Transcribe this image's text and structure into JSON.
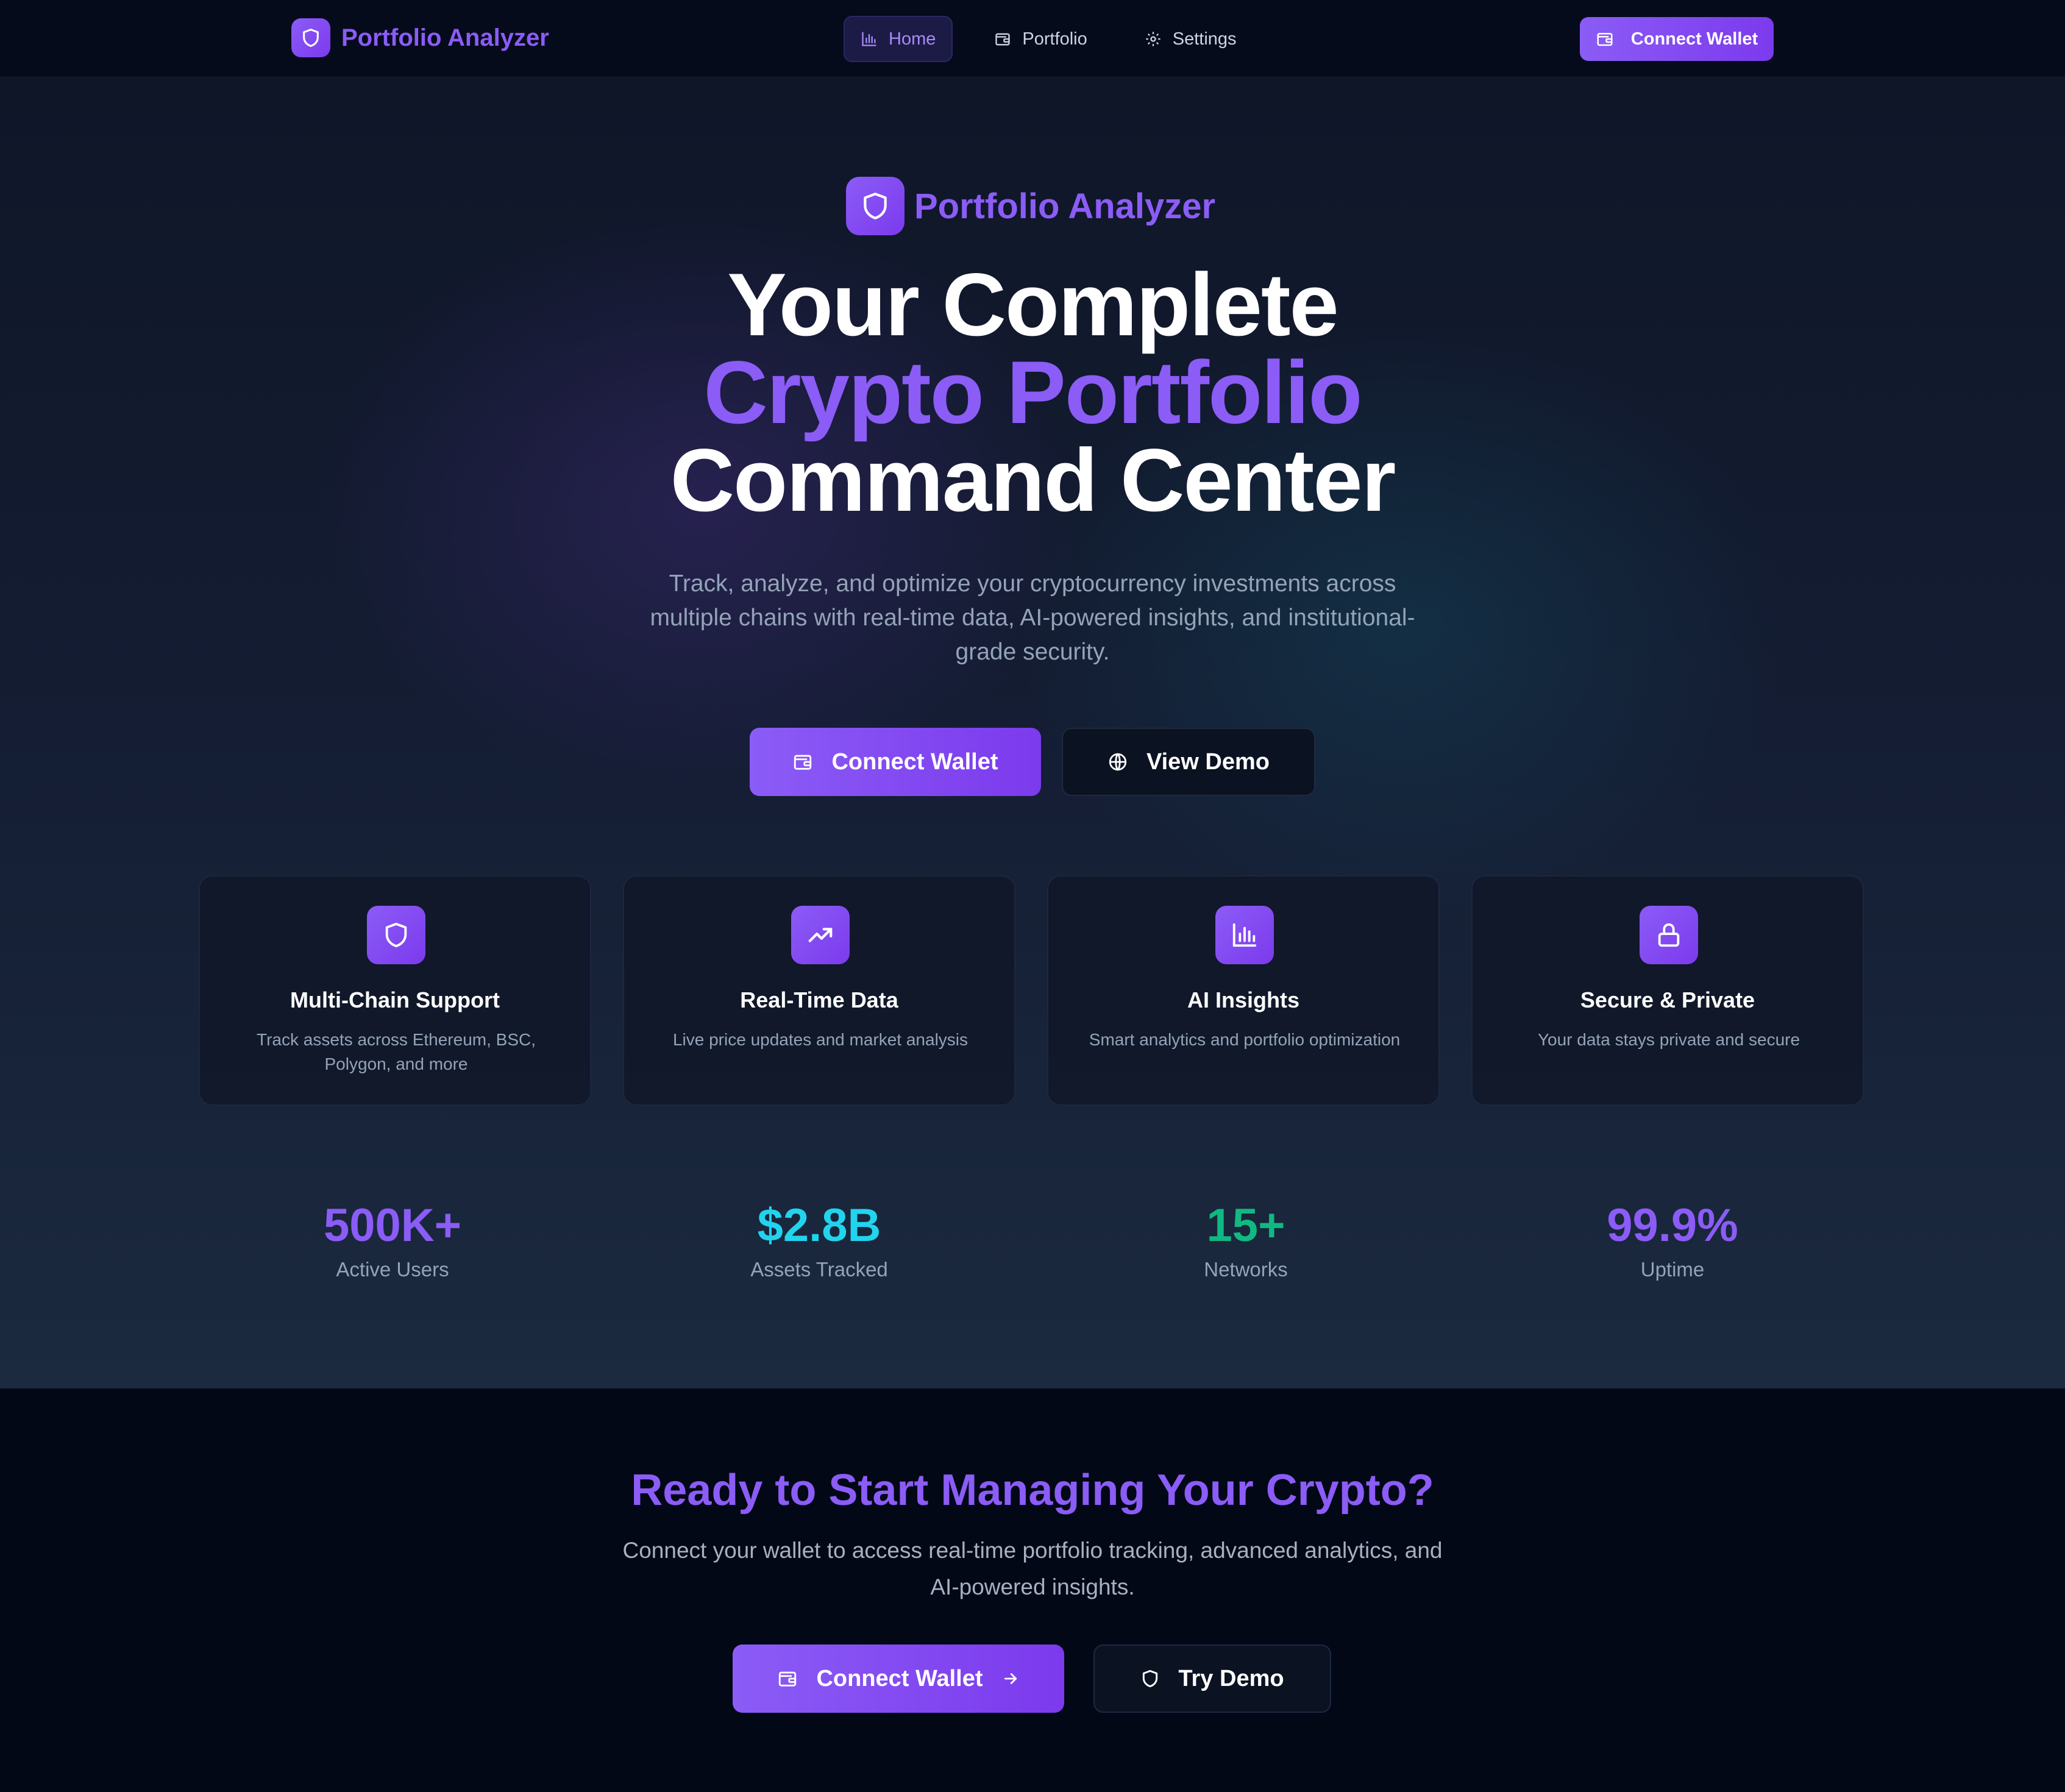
{
  "nav": {
    "brand": "Portfolio Analyzer",
    "links": [
      {
        "label": "Home",
        "icon": "bar-chart-icon",
        "active": true
      },
      {
        "label": "Portfolio",
        "icon": "wallet-icon",
        "active": false
      },
      {
        "label": "Settings",
        "icon": "gear-icon",
        "active": false
      }
    ],
    "cta_label": "Connect Wallet"
  },
  "hero": {
    "brand": "Portfolio Analyzer",
    "headline": {
      "line1": "Your Complete",
      "line2": "Crypto Portfolio",
      "line3": "Command Center"
    },
    "subtitle": "Track, analyze, and optimize your cryptocurrency investments across multiple chains with real-time data, AI-powered insights, and institutional-grade security.",
    "primary_button": "Connect Wallet",
    "secondary_button": "View Demo"
  },
  "features": [
    {
      "icon": "shield-icon",
      "title": "Multi-Chain Support",
      "description": "Track assets across Ethereum, BSC, Polygon, and more"
    },
    {
      "icon": "trending-up-icon",
      "title": "Real-Time Data",
      "description": "Live price updates and market analysis"
    },
    {
      "icon": "bar-chart-icon",
      "title": "AI Insights",
      "description": "Smart analytics and portfolio optimization"
    },
    {
      "icon": "lock-icon",
      "title": "Secure & Private",
      "description": "Your data stays private and secure"
    }
  ],
  "stats": [
    {
      "value": "500K+",
      "label": "Active Users",
      "color": "#8b5cf6"
    },
    {
      "value": "$2.8B",
      "label": "Assets Tracked",
      "color": "#22d3ee"
    },
    {
      "value": "15+",
      "label": "Networks",
      "color": "#10b981"
    },
    {
      "value": "99.9%",
      "label": "Uptime",
      "color": "#8b5cf6"
    }
  ],
  "cta": {
    "title": "Ready to Start Managing Your Crypto?",
    "description": "Connect your wallet to access real-time portfolio tracking, advanced analytics, and AI-powered insights.",
    "primary_button": "Connect Wallet",
    "secondary_button": "Try Demo"
  },
  "colors": {
    "accent": "#8b5cf6",
    "accent_dark": "#7c3aed",
    "background": "#050a1a",
    "muted_text": "#94a3b8"
  }
}
